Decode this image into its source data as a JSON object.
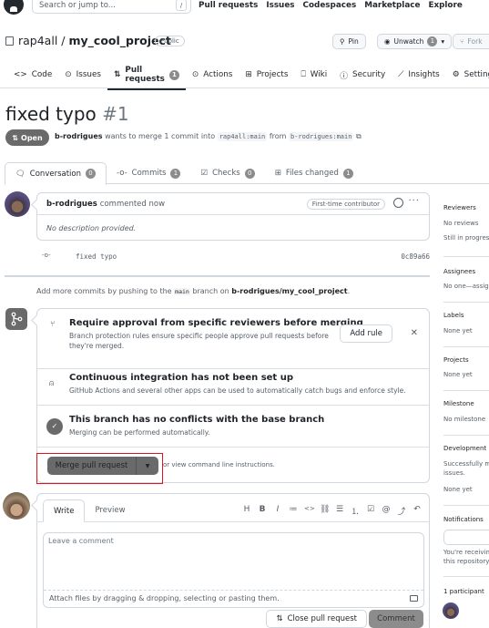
{
  "header": {
    "search_placeholder": "Search or jump to...",
    "search_shortcut": "/",
    "nav": [
      "Pull requests",
      "Issues",
      "Codespaces",
      "Marketplace",
      "Explore"
    ]
  },
  "repo": {
    "owner": "rap4all",
    "separator": "/",
    "name": "my_cool_project",
    "visibility": "Public",
    "pin_label": "Pin",
    "unwatch_label": "Unwatch",
    "watch_count": "1",
    "fork_label": "Fork"
  },
  "repo_nav": [
    {
      "label": "Code",
      "icon": "code-icon"
    },
    {
      "label": "Issues",
      "icon": "issue-icon"
    },
    {
      "label": "Pull requests",
      "icon": "pull-request-icon",
      "count": "1",
      "active": true
    },
    {
      "label": "Actions",
      "icon": "play-icon"
    },
    {
      "label": "Projects",
      "icon": "table-icon"
    },
    {
      "label": "Wiki",
      "icon": "book-icon"
    },
    {
      "label": "Security",
      "icon": "shield-icon"
    },
    {
      "label": "Insights",
      "icon": "graph-icon"
    },
    {
      "label": "Settings",
      "icon": "gear-icon"
    }
  ],
  "pr": {
    "title": "fixed typo",
    "number": "#1",
    "state": "Open",
    "author": "b-rodrigues",
    "meta_text": "wants to merge 1 commit into",
    "base_branch": "rap4all:main",
    "from_text": "from",
    "head_branch": "b-rodrigues:main"
  },
  "pr_tabs": [
    {
      "label": "Conversation",
      "count": "0",
      "active": true
    },
    {
      "label": "Commits",
      "count": "1"
    },
    {
      "label": "Checks",
      "count": "0"
    },
    {
      "label": "Files changed",
      "count": "1"
    }
  ],
  "comment": {
    "author": "b-rodrigues",
    "action": "commented now",
    "badge": "First-time contributor",
    "body": "No description provided."
  },
  "commit": {
    "message": "fixed typo",
    "sha": "0c89a66"
  },
  "push_note": {
    "prefix": "Add more commits by pushing to the",
    "branch": "main",
    "middle": "branch on",
    "repo": "b-rodrigues/my_cool_project",
    "suffix": "."
  },
  "merge_box": {
    "sections": [
      {
        "title": "Require approval from specific reviewers before merging",
        "desc": "Branch protection rules ensure specific people approve pull requests before they're merged."
      },
      {
        "title": "Continuous integration has not been set up",
        "desc": "GitHub Actions and several other apps can be used to automatically catch bugs and enforce style."
      },
      {
        "title": "This branch has no conflicts with the base branch",
        "desc": "Merging can be performed automatically."
      }
    ],
    "add_rule_label": "Add rule",
    "merge_label": "Merge pull request",
    "cli_note": "or view command line instructions."
  },
  "composer": {
    "tabs": [
      "Write",
      "Preview"
    ],
    "placeholder": "Leave a comment",
    "attach_text": "Attach files by dragging & dropping, selecting or pasting them.",
    "close_label": "Close pull request",
    "comment_label": "Comment",
    "toolbar": [
      "H",
      "B",
      "I",
      "≔",
      "<>",
      "⛓",
      "☰",
      "⒈",
      "☑",
      "@",
      "⤴",
      "↶"
    ]
  },
  "sidebar": {
    "reviewers": {
      "heading": "Reviewers",
      "line1": "No reviews",
      "line2": "Still in progress?"
    },
    "assignees": {
      "heading": "Assignees",
      "line1": "No one—assign yourself"
    },
    "labels": {
      "heading": "Labels",
      "line1": "None yet"
    },
    "projects": {
      "heading": "Projects",
      "line1": "None yet"
    },
    "milestone": {
      "heading": "Milestone",
      "line1": "No milestone"
    },
    "development": {
      "heading": "Development",
      "line1": "Successfully merging this pull request may close these",
      "line2": "issues.",
      "line3": "None yet"
    },
    "notifications": {
      "heading": "Notifications",
      "line1": "You're receiving notifications because you're watching",
      "line2": "this repository."
    },
    "participants": {
      "heading": "1 participant"
    }
  },
  "colors": {
    "state_badge": "#6a6a6a",
    "merge_button": "#6a6a6a",
    "highlight_box": "#e0141e",
    "counter": "#8c8c8c"
  }
}
